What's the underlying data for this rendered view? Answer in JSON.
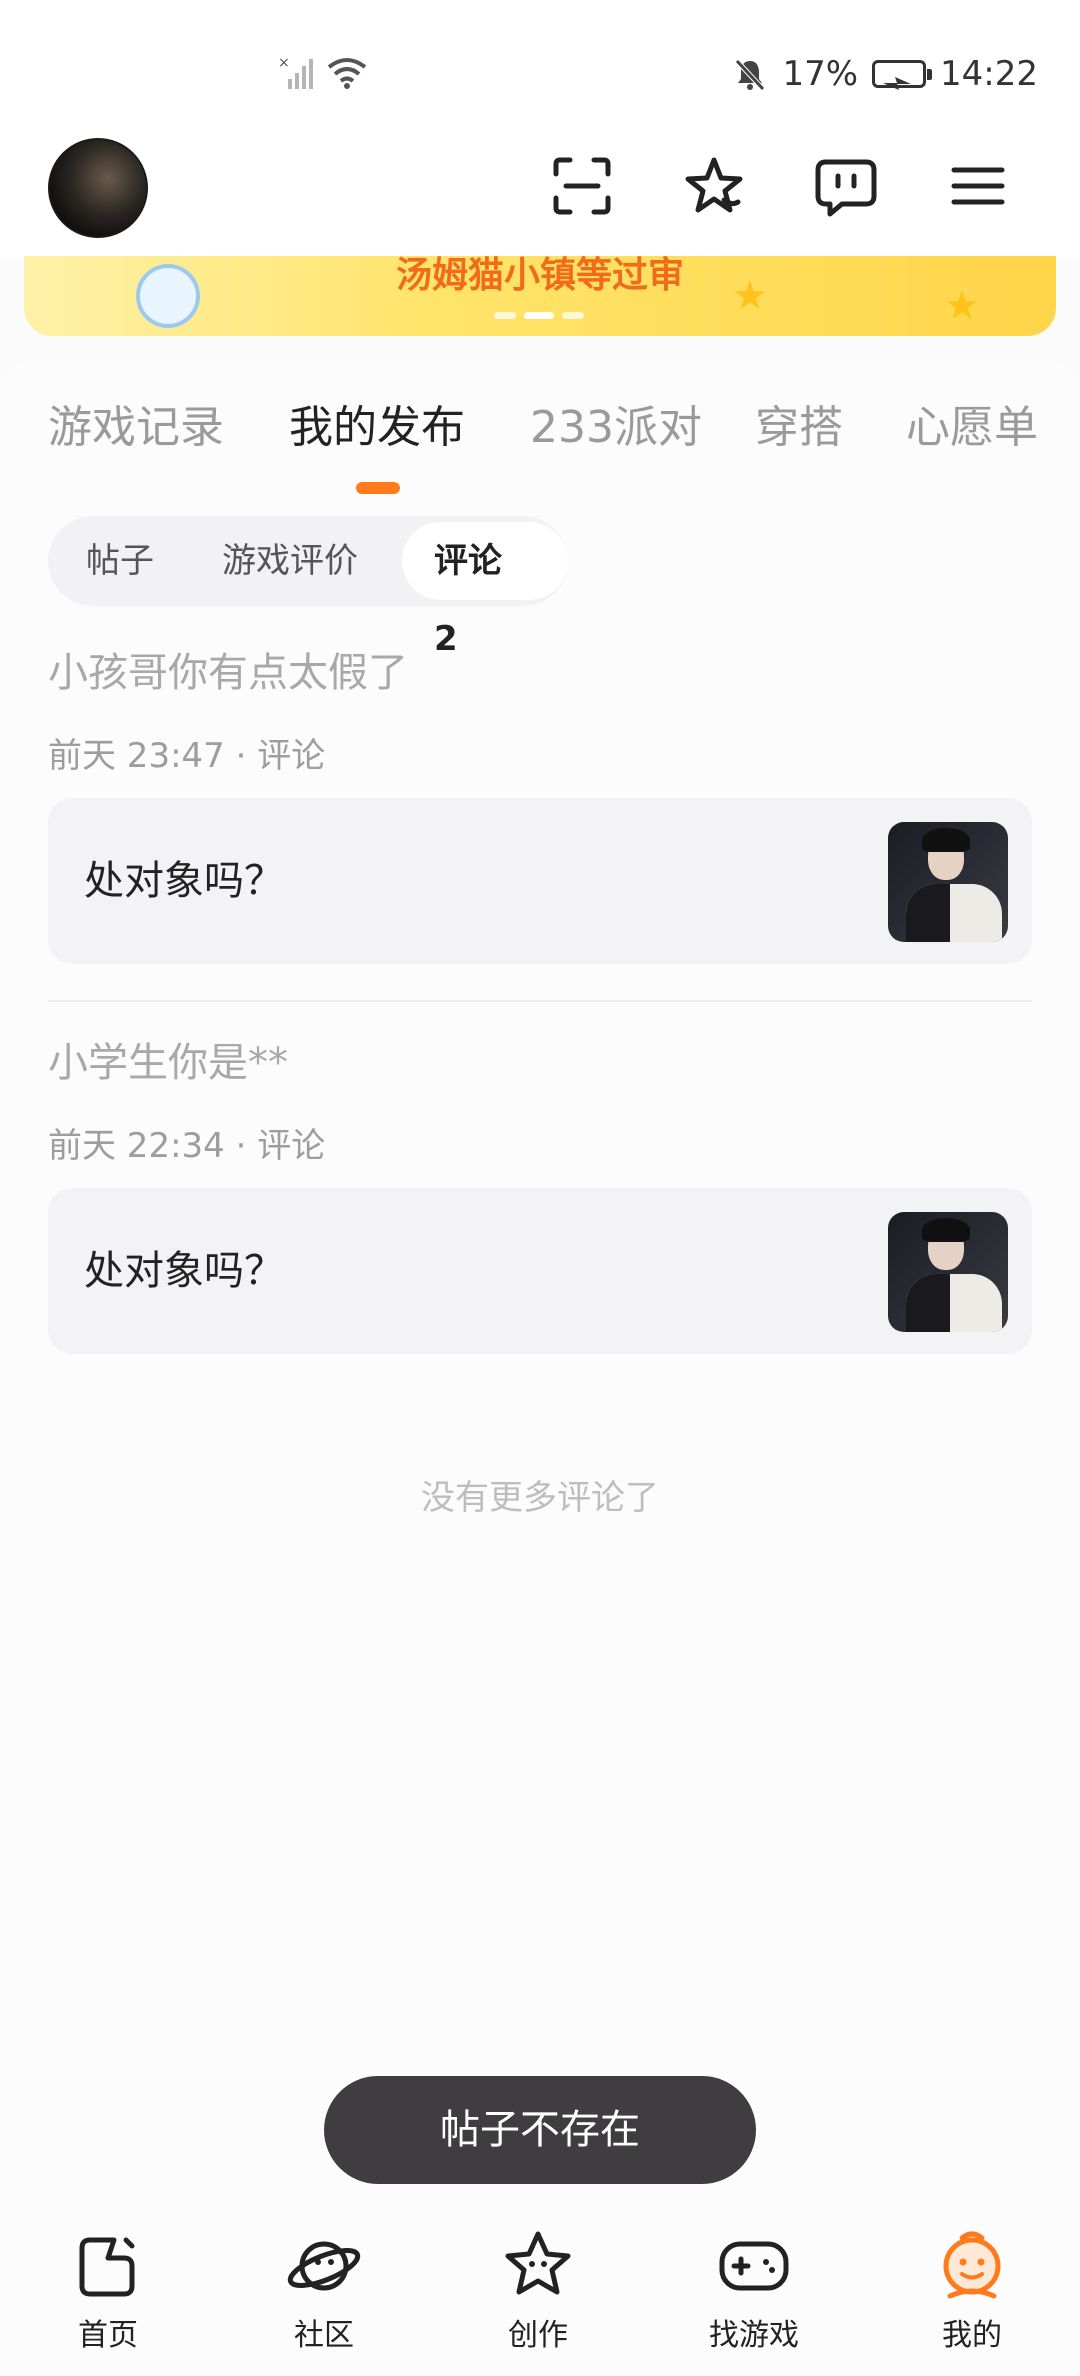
{
  "status_bar": {
    "battery": "17%",
    "time": "14:22"
  },
  "banner": {
    "title": "汤姆猫小镇等过审"
  },
  "profile_tabs": [
    {
      "label": "游戏记录"
    },
    {
      "label": "我的发布"
    },
    {
      "label": "233派对"
    },
    {
      "label": "穿搭"
    },
    {
      "label": "心愿单"
    }
  ],
  "active_profile_tab": "我的发布",
  "sub_tabs": [
    {
      "label": "帖子"
    },
    {
      "label": "游戏评价"
    },
    {
      "label": "评论 2"
    }
  ],
  "comments": [
    {
      "text": "小孩哥你有点太假了",
      "meta": "前天 23:47 · 评论",
      "post_title": "处对象吗？"
    },
    {
      "text": "小学生你是**",
      "meta": "前天 22:34 · 评论",
      "post_title": "处对象吗？"
    }
  ],
  "no_more_text": "没有更多评论了",
  "toast": "帖子不存在",
  "bottom_nav": [
    {
      "label": "首页",
      "icon": "home-icon"
    },
    {
      "label": "社区",
      "icon": "planet-icon"
    },
    {
      "label": "创作",
      "icon": "star-create-icon"
    },
    {
      "label": "找游戏",
      "icon": "gamepad-icon"
    },
    {
      "label": "我的",
      "icon": "profile-face-icon"
    }
  ],
  "active_nav": "我的",
  "colors": {
    "accent": "#ff7a1a",
    "banner_title": "#f26b1d",
    "toast_bg": "#3f3d3f"
  }
}
